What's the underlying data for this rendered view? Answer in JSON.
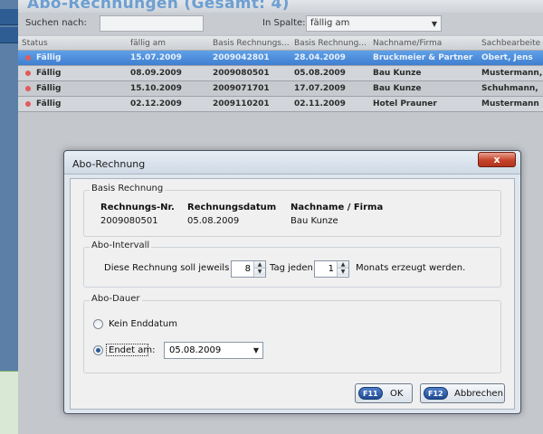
{
  "background": {
    "app_title": "Abo-Rechnungen (Gesamt: 4)",
    "search_label": "Suchen nach:",
    "search_value": "",
    "column_filter_label": "In Spalte:",
    "column_filter_value": "fällig am",
    "columns": [
      "Status",
      "fällig am",
      "Basis Rechnungs...",
      "Basis Rechnung...",
      "Nachname/Firma",
      "Sachbearbeite"
    ],
    "rows": [
      {
        "status": "Fällig",
        "due": "15.07.2009",
        "nr": "2009042801",
        "date": "28.04.2009",
        "name": "Bruckmeier & Partner",
        "clerk": "Obert, Jens",
        "selected": true
      },
      {
        "status": "Fällig",
        "due": "08.09.2009",
        "nr": "2009080501",
        "date": "05.08.2009",
        "name": "Bau Kunze",
        "clerk": "Mustermann,",
        "selected": false
      },
      {
        "status": "Fällig",
        "due": "15.10.2009",
        "nr": "2009071701",
        "date": "17.07.2009",
        "name": "Bau Kunze",
        "clerk": "Schuhmann,",
        "selected": false
      },
      {
        "status": "Fällig",
        "due": "02.12.2009",
        "nr": "2009110201",
        "date": "02.11.2009",
        "name": "Hotel Prauner",
        "clerk": "Mustermann",
        "selected": false
      }
    ],
    "status_dot_color": "#e25a5a",
    "selection_color": "#3f7fd0"
  },
  "dialog": {
    "title": "Abo-Rechnung",
    "close_glyph": "x",
    "basis": {
      "group_title": "Basis Rechnung",
      "nr_header": "Rechnungs-Nr.",
      "date_header": "Rechnungsdatum",
      "name_header": "Nachname / Firma",
      "nr_value": "2009080501",
      "date_value": "05.08.2009",
      "name_value": "Bau Kunze"
    },
    "interval": {
      "group_title": "Abo-Intervall",
      "text_before": "Diese Rechnung soll jeweils am",
      "day_value": "8",
      "text_middle": "Tag jeden",
      "month_value": "1",
      "text_after": "Monats erzeugt werden."
    },
    "duration": {
      "group_title": "Abo-Dauer",
      "option_none": "Kein Enddatum",
      "option_end": "Endet am:",
      "selected_option": "Endet am:",
      "end_date_value": "05.08.2009"
    },
    "buttons": {
      "ok_key": "F11",
      "ok_label": "OK",
      "cancel_key": "F12",
      "cancel_label": "Abbrechen"
    }
  }
}
